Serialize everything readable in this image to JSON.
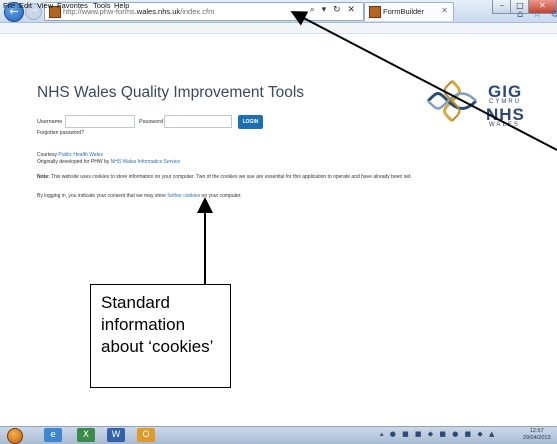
{
  "browser": {
    "address_url_prefix": "http://www.phw-forms.",
    "address_url_domain": "wales.nhs.uk",
    "address_url_suffix": "/index.cfm",
    "address_icons": "⌕ ▾ ↻ ✕",
    "tab_title": "FormBuilder",
    "tab_close": "✕",
    "back_glyph": "←",
    "forward_glyph": "→",
    "window_controls": {
      "minimize": "–",
      "maximize": "□",
      "close": "✕"
    },
    "toolbar_icons": "⌂ ☆ ⚙",
    "menu": [
      "File",
      "Edit",
      "View",
      "Favorites",
      "Tools",
      "Help"
    ]
  },
  "page": {
    "title": "NHS Wales Quality Improvement Tools",
    "username_label": "Username",
    "password_label": "Password",
    "login_button": "LOGIN",
    "forgotten_password": "Forgotten password?",
    "courtesy_prefix": "Courtesy",
    "courtesy_link": "Public Health Wales",
    "developed_prefix": "Originally developed for PHW by",
    "developed_link": "NHS Wales Informatics Service",
    "note_label": "Note:",
    "note_text": " This website uses cookies to store information on your computer. Two of the cookies we use are essential for this application to operate and have already been set.",
    "consent_prefix": "By logging in, you indicate your consent that we may store",
    "consent_link": "further cookies",
    "consent_suffix": "on your computer.",
    "logo": {
      "line1": "GIG",
      "line2": "CYMRU",
      "line3": "NHS",
      "line4": "WALES"
    }
  },
  "annotation": {
    "callout_text": "Standard information about ‘cookies’"
  },
  "taskbar": {
    "tray_icons": "▴ ● ■ ■ ◆ ■ ● ■ ◆ ▲",
    "clock_time": "12:57",
    "clock_date": "29/04/2013"
  },
  "colors": {
    "accent": "#1c6fb0",
    "link": "#2a6fb6",
    "logo": "#2d4a73"
  }
}
